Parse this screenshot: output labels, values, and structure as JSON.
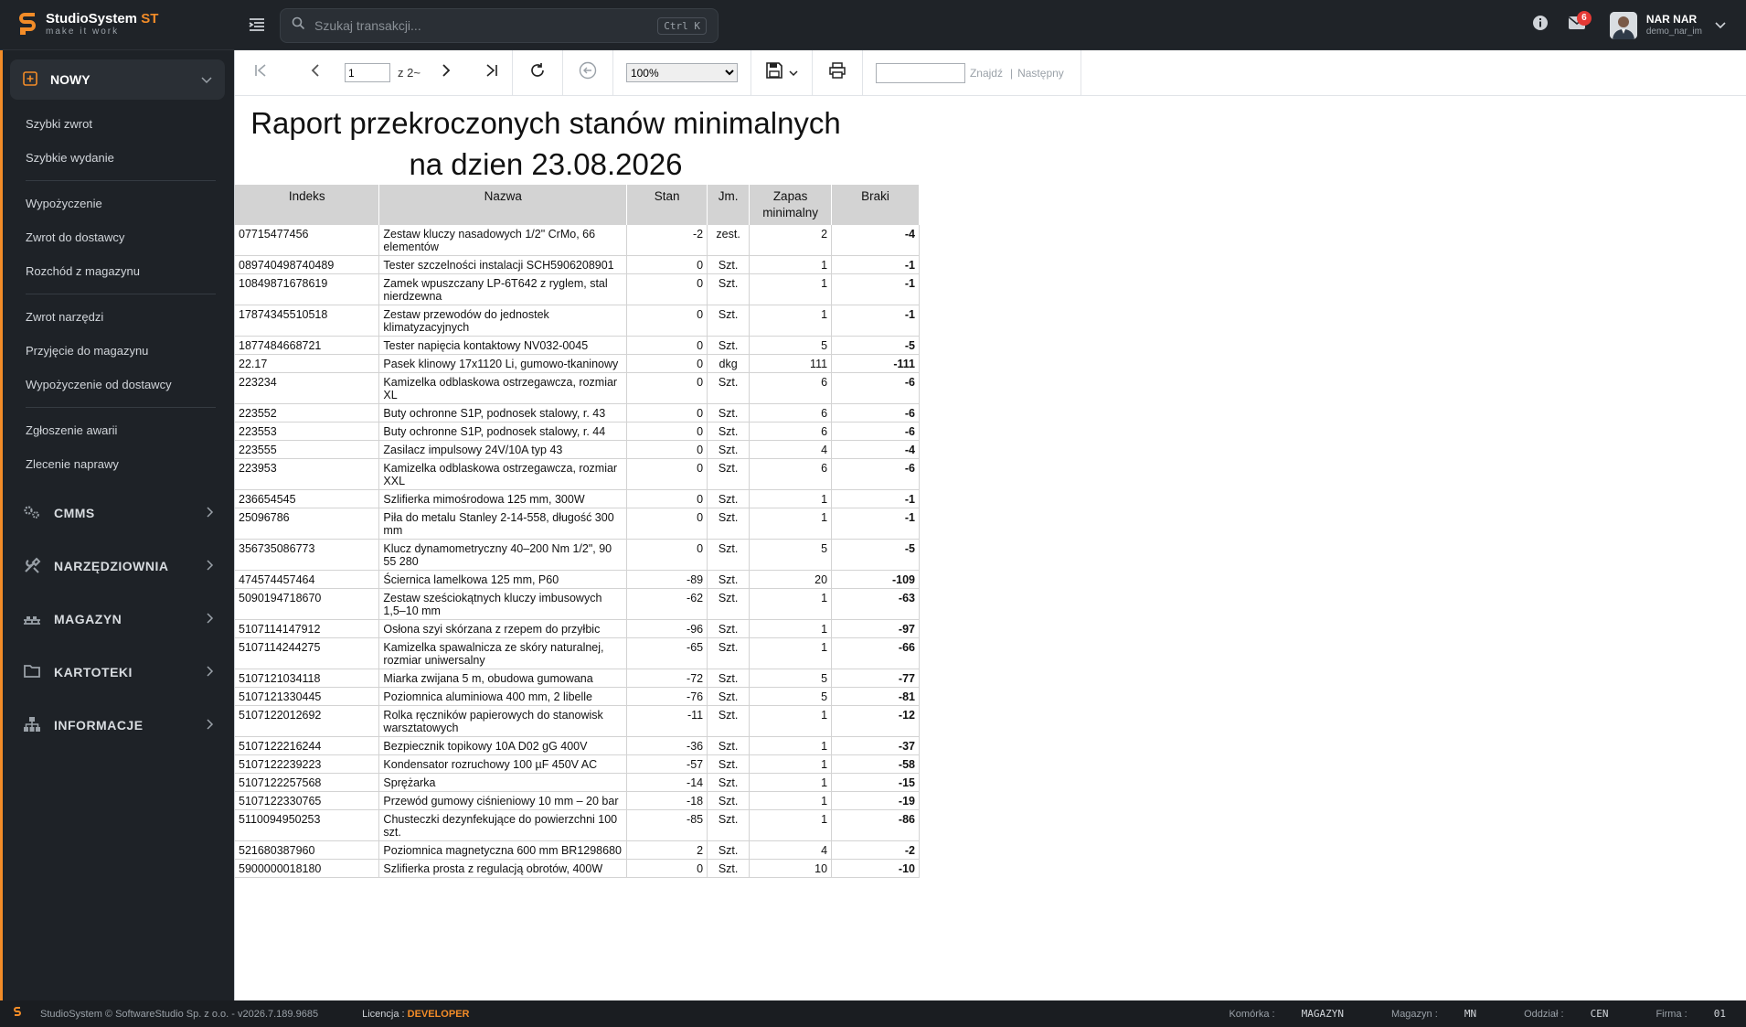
{
  "brand": {
    "name": "StudioSystem",
    "accent": "ST",
    "tagline": "make it work"
  },
  "search": {
    "placeholder": "Szukaj transakcji...",
    "shortcut": "Ctrl K"
  },
  "header": {
    "messages_badge": "6",
    "user_name": "NAR NAR",
    "user_login": "demo_nar_im"
  },
  "sidebar": {
    "active_section": "NOWY",
    "items_group1": [
      "Szybki zwrot",
      "Szybkie wydanie"
    ],
    "items_group2": [
      "Wypożyczenie",
      "Zwrot do dostawcy",
      "Rozchód z magazynu"
    ],
    "items_group3": [
      "Zwrot narzędzi",
      "Przyjęcie do magazynu",
      "Wypożyczenie od dostawcy"
    ],
    "items_group4": [
      "Zgłoszenie awarii",
      "Zlecenie naprawy"
    ],
    "groups": [
      "CMMS",
      "NARZĘDZIOWNIA",
      "MAGAZYN",
      "KARTOTEKI",
      "INFORMACJE"
    ]
  },
  "toolbar": {
    "page_value": "1",
    "page_of": "z 2~",
    "zoom": "100%",
    "zoom_options": [
      "100%"
    ],
    "find_label": "Znajdź",
    "next_label": "Następny"
  },
  "report": {
    "title_line1": "Raport przekroczonych stanów minimalnych",
    "title_line2": "na dzien 23.08.2026",
    "columns": [
      "Indeks",
      "Nazwa",
      "Stan",
      "Jm.",
      "Zapas minimalny",
      "Braki"
    ],
    "rows": [
      [
        "07715477456",
        "Zestaw kluczy nasadowych 1/2\" CrMo, 66 elementów",
        "-2",
        "zest.",
        "2",
        "-4"
      ],
      [
        "089740498740489",
        "Tester szczelności instalacji SCH5906208901",
        "0",
        "Szt.",
        "1",
        "-1"
      ],
      [
        "10849871678619",
        "Zamek wpuszczany LP-6T642 z ryglem, stal nierdzewna",
        "0",
        "Szt.",
        "1",
        "-1"
      ],
      [
        "17874345510518",
        "Zestaw przewodów do jednostek klimatyzacyjnych",
        "0",
        "Szt.",
        "1",
        "-1"
      ],
      [
        "1877484668721",
        "Tester napięcia kontaktowy NV032-0045",
        "0",
        "Szt.",
        "5",
        "-5"
      ],
      [
        "22.17",
        "Pasek klinowy 17x1120 Li, gumowo-tkaninowy",
        "0",
        "dkg",
        "111",
        "-111"
      ],
      [
        "223234",
        "Kamizelka odblaskowa ostrzegawcza, rozmiar XL",
        "0",
        "Szt.",
        "6",
        "-6"
      ],
      [
        "223552",
        "Buty ochronne S1P, podnosek stalowy, r. 43",
        "0",
        "Szt.",
        "6",
        "-6"
      ],
      [
        "223553",
        "Buty ochronne S1P, podnosek stalowy, r. 44",
        "0",
        "Szt.",
        "6",
        "-6"
      ],
      [
        "223555",
        "Zasilacz impulsowy 24V/10A typ 43",
        "0",
        "Szt.",
        "4",
        "-4"
      ],
      [
        "223953",
        "Kamizelka odblaskowa ostrzegawcza, rozmiar XXL",
        "0",
        "Szt.",
        "6",
        "-6"
      ],
      [
        "236654545",
        "Szlifierka mimośrodowa 125 mm, 300W",
        "0",
        "Szt.",
        "1",
        "-1"
      ],
      [
        "25096786",
        "Piła do metalu Stanley 2-14-558, długość 300 mm",
        "0",
        "Szt.",
        "1",
        "-1"
      ],
      [
        "356735086773",
        "Klucz dynamometryczny 40–200 Nm 1/2\", 90 55 280",
        "0",
        "Szt.",
        "5",
        "-5"
      ],
      [
        "474574457464",
        "Ściernica lamelkowa 125 mm, P60",
        "-89",
        "Szt.",
        "20",
        "-109"
      ],
      [
        "5090194718670",
        "Zestaw sześciokątnych kluczy imbusowych 1,5–10 mm",
        "-62",
        "Szt.",
        "1",
        "-63"
      ],
      [
        "5107114147912",
        "Osłona szyi skórzana z rzepem do przyłbic",
        "-96",
        "Szt.",
        "1",
        "-97"
      ],
      [
        "5107114244275",
        "Kamizelka spawalnicza ze skóry naturalnej, rozmiar uniwersalny",
        "-65",
        "Szt.",
        "1",
        "-66"
      ],
      [
        "5107121034118",
        "Miarka zwijana 5 m, obudowa gumowana",
        "-72",
        "Szt.",
        "5",
        "-77"
      ],
      [
        "5107121330445",
        "Poziomnica aluminiowa 400 mm, 2 libelle",
        "-76",
        "Szt.",
        "5",
        "-81"
      ],
      [
        "5107122012692",
        "Rolka ręczników papierowych do stanowisk warsztatowych",
        "-11",
        "Szt.",
        "1",
        "-12"
      ],
      [
        "5107122216244",
        "Bezpiecznik topikowy 10A D02 gG 400V",
        "-36",
        "Szt.",
        "1",
        "-37"
      ],
      [
        "5107122239223",
        "Kondensator rozruchowy 100 µF 450V AC",
        "-57",
        "Szt.",
        "1",
        "-58"
      ],
      [
        "5107122257568",
        "Sprężarka",
        "-14",
        "Szt.",
        "1",
        "-15"
      ],
      [
        "5107122330765",
        "Przewód gumowy ciśnieniowy 10 mm – 20 bar",
        "-18",
        "Szt.",
        "1",
        "-19"
      ],
      [
        "5110094950253",
        "Chusteczki dezynfekujące do powierzchni 100 szt.",
        "-85",
        "Szt.",
        "1",
        "-86"
      ],
      [
        "521680387960",
        "Poziomnica magnetyczna 600 mm BR1298680",
        "2",
        "Szt.",
        "4",
        "-2"
      ],
      [
        "5900000018180",
        "Szlifierka prosta z regulacją obrotów, 400W",
        "0",
        "Szt.",
        "10",
        "-10"
      ]
    ]
  },
  "footer": {
    "copyright": "StudioSystem © SoftwareStudio Sp. z o.o. - v2026.7.189.9685",
    "license_label": "Licencja :",
    "license_value": "DEVELOPER",
    "cell_label": "Komórka :",
    "cell_value": "MAGAZYN",
    "store_label": "Magazyn :",
    "store_value": "MN",
    "branch_label": "Oddział :",
    "branch_value": "CEN",
    "company_label": "Firma :",
    "company_value": "01"
  },
  "colors": {
    "accent": "#f28c28",
    "sidebar_bg": "#1e2227",
    "badge": "#e53935"
  }
}
